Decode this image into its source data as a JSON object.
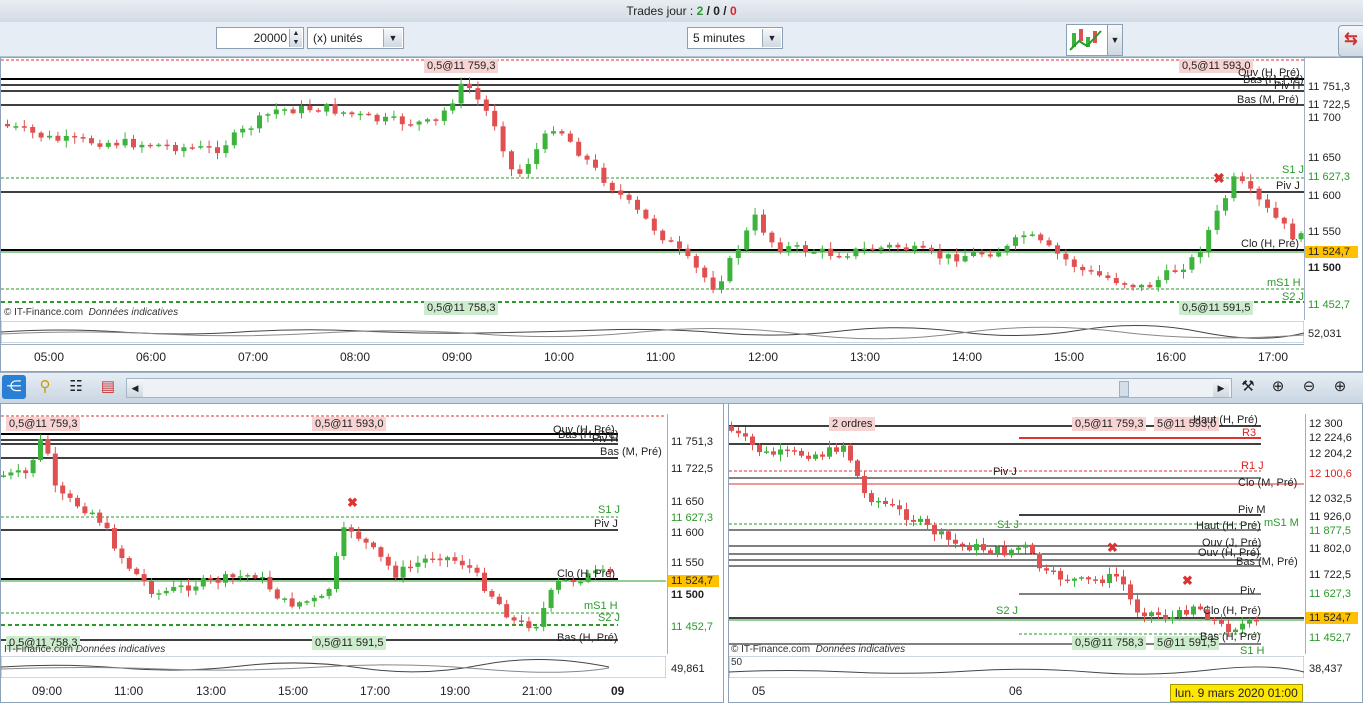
{
  "window": {
    "title_prefix": "Trades jour : ",
    "trades_won": "2",
    "sep1": " / ",
    "trades_neutral": "0",
    "sep2": " / ",
    "trades_lost": "0"
  },
  "toolbar": {
    "quantity": "20000",
    "units": "(x) unités",
    "timeframe": "5 minutes",
    "spin_up": "▲",
    "spin_down": "▼",
    "dropdown_arrow": "▼"
  },
  "colors": {
    "bull": "#3cb43c",
    "bear": "#e05050",
    "support": "#2a9a2a",
    "resistance": "#d22",
    "last_price_bg": "#ffc000"
  },
  "main_chart": {
    "order_top_left": "0,5@11 759,3",
    "order_top_right": "0,5@11 593,0",
    "order_bottom_left": "0,5@11 758,3",
    "order_bottom_right": "0,5@11 591,5",
    "level_labels": {
      "ouv_h": "Ouv (H, Pré)",
      "bas_h": "Bas (H, Pré)",
      "piv_h": "Piv H",
      "bas_m": "Bas (M, Pré)",
      "s1_j": "S1 J",
      "piv_j": "Piv J",
      "clo_h": "Clo (H, Pré)",
      "ms1_h": "mS1 H",
      "s2_j": "S2 J"
    },
    "price_axis": [
      "11 751,3",
      "11 722,5",
      "11 700",
      "11 650",
      "11 627,3",
      "11 600",
      "11 550",
      "11 524,7",
      "11 500",
      "11 452,7"
    ],
    "last_price": "11 524,7",
    "indicator_value": "52,031",
    "copyright": "© IT-Finance.com",
    "copyright_note": "Données indicatives",
    "time_axis": [
      "05:00",
      "06:00",
      "07:00",
      "08:00",
      "09:00",
      "10:00",
      "11:00",
      "12:00",
      "13:00",
      "14:00",
      "15:00",
      "16:00",
      "17:00"
    ]
  },
  "bottom_left_chart": {
    "order_top_left": "0,5@11 759,3",
    "order_top_mid": "0,5@11 593,0",
    "order_bottom_left": "0,5@11 758,3",
    "order_bottom_mid": "0,5@11 591,5",
    "level_labels": {
      "ouv_h": "Ouv (H, Pré)",
      "bas_h": "Bas (H, Pré)",
      "piv_h": "Piv H",
      "bas_m": "Bas (M, Pré)",
      "s1_j": "S1 J",
      "piv_j": "Piv J",
      "clo_h": "Clo (H, Pré)",
      "ms1_h": "mS1 H",
      "s2_j": "S2 J",
      "bas_h2": "Bas (H, Pré)"
    },
    "price_axis": [
      "11 751,3",
      "11 722,5",
      "11 650",
      "11 627,3",
      "11 600",
      "11 550",
      "11 524,7",
      "11 500",
      "11 452,7"
    ],
    "last_price": "11 524,7",
    "indicator_value": "49,861",
    "copyright": "IT-Finance.com",
    "copyright_note": "Données indicatives",
    "time_axis": [
      "09:00",
      "11:00",
      "13:00",
      "15:00",
      "17:00",
      "19:00",
      "21:00",
      "09"
    ]
  },
  "bottom_right_chart": {
    "order_box": "2 ordres",
    "order_top_a": "0,5@11 759,3",
    "order_top_b": "5@11 593,0",
    "order_bottom_a": "0,5@11 758,3",
    "order_bottom_b": "5@11 591,5",
    "level_labels": {
      "haut_h": "Haut (H, Pré)",
      "r3": "R3",
      "r1_j": "R1 J",
      "clo_m": "Clo (M, Pré)",
      "piv_j": "Piv J",
      "piv_m": "Piv M",
      "haut_h2": "Haut (H, Pré)",
      "ms1_m": "mS1 M",
      "ouv_j": "Ouv (J, Pré)",
      "ouv_h": "Ouv (H, Pré)",
      "bas_m": "Bas (M, Pré)",
      "s1_j": "S1 J",
      "s2_j": "S2 J",
      "piv": "Piv",
      "clo_h": "Clo (H, Pré)",
      "bas_h": "Bas (H, Pré)",
      "s1_h": "S1 H"
    },
    "price_axis": [
      "12 300",
      "12 224,6",
      "12 204,2",
      "12 100,6",
      "12 032,5",
      "11 926,0",
      "11 877,5",
      "11 802,0",
      "11 722,5",
      "11 627,3",
      "11 524,7",
      "11 452,7"
    ],
    "last_price": "11 524,7",
    "indicator_value": "38,437",
    "indicator_scale": "50",
    "copyright": "© IT-Finance.com",
    "copyright_note": "Données indicatives",
    "time_axis": [
      "05",
      "06"
    ],
    "date": "lun. 9 mars 2020 01:00"
  }
}
